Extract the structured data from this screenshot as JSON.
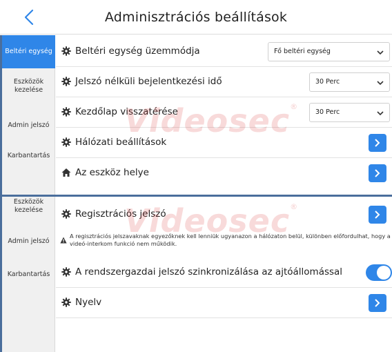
{
  "header": {
    "title": "Adminisztrációs beállítások",
    "back_icon": "chevron-left-icon"
  },
  "accent_color": "#2f86e8",
  "watermark": {
    "text": "Videosec",
    "mark": "®"
  },
  "top_sidebar": {
    "items": [
      {
        "label": "Beltéri egység",
        "active": true
      },
      {
        "label": "Eszközök kezelése",
        "active": false
      },
      {
        "label": "Admin jelszó",
        "active": false
      },
      {
        "label": "Karbantartás",
        "active": false
      }
    ]
  },
  "top_rows": [
    {
      "label": "Beltéri egység üzemmódja",
      "icon": "gear-icon",
      "control": "select",
      "value": "Fő beltéri egység"
    },
    {
      "label": "Jelszó nélküli bejelentkezési idő",
      "icon": "gear-icon",
      "control": "select",
      "value": "30 Perc"
    },
    {
      "label": "Kezdőlap visszatérése",
      "icon": "gear-icon",
      "control": "select",
      "value": "30 Perc"
    },
    {
      "label": "Hálózati beállítások",
      "icon": "gear-icon",
      "control": "arrow"
    },
    {
      "label": "Az eszköz helye",
      "icon": "home-icon",
      "control": "arrow"
    }
  ],
  "bottom_sidebar": {
    "items": [
      {
        "label": "Eszközök kezelése",
        "active": false
      },
      {
        "label": "Admin jelszó",
        "active": false
      },
      {
        "label": "Karbantartás",
        "active": false
      }
    ]
  },
  "bottom_rows": [
    {
      "label": "Regisztrációs jelszó",
      "icon": "gear-icon",
      "control": "arrow"
    },
    {
      "label": "A rendszergazdai jelszó szinkronizálása az ajtóállomással",
      "icon": "gear-icon",
      "control": "toggle",
      "toggle_on": true
    },
    {
      "label": "Nyelv",
      "icon": "gear-icon",
      "control": "arrow"
    }
  ],
  "warning": {
    "icon": "warning-icon",
    "text": "A regisztrációs jelszavaknak egyezőknek kell lenniük ugyanazon a hálózaton belül, különben előfordulhat, hogy a videó-interkom funkció nem működik."
  }
}
